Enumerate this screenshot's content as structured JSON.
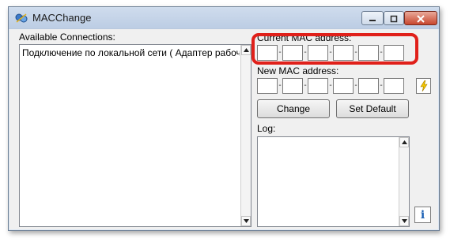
{
  "window": {
    "title": "MACChange"
  },
  "connections": {
    "label": "Available Connections:",
    "items": [
      "Подключение по локальной сети ( Адаптер рабочего"
    ]
  },
  "current_mac": {
    "label": "Current MAC address:",
    "octets": [
      "",
      "",
      "",
      "",
      "",
      ""
    ]
  },
  "new_mac": {
    "label": "New MAC address:",
    "octets": [
      "",
      "",
      "",
      "",
      "",
      ""
    ]
  },
  "buttons": {
    "change_label": "Change",
    "set_default_label": "Set Default",
    "info_label": "i"
  },
  "log": {
    "label": "Log:",
    "content": ""
  },
  "icons": {
    "app": "network-icon",
    "random": "lightning-icon",
    "info": "info-icon"
  },
  "colors": {
    "highlight": "#e0201a",
    "close_button": "#c8472e",
    "title_bar": "#c3d3e8"
  }
}
